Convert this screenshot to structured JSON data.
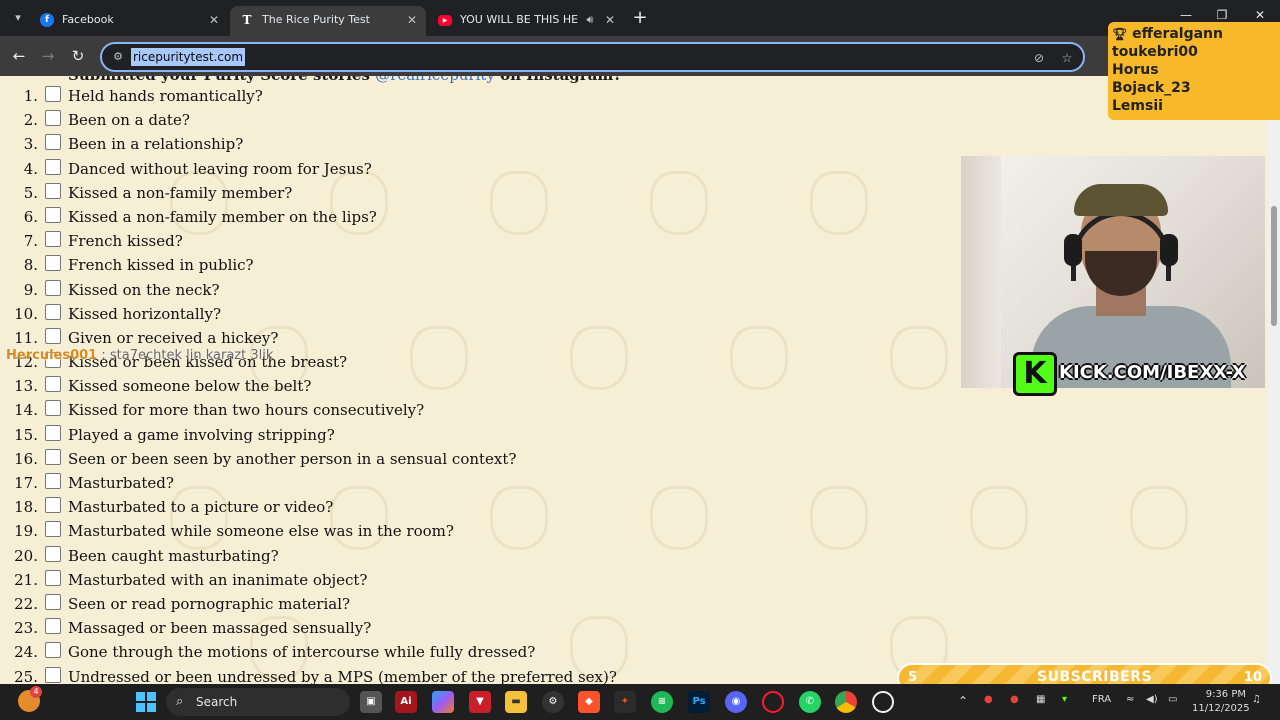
{
  "browser": {
    "tabs": [
      {
        "title": "Facebook",
        "favicon": "facebook-icon",
        "color": "#1877f2"
      },
      {
        "title": "The Rice Purity Test",
        "favicon": "t-logo-icon",
        "color": "#ffffff"
      },
      {
        "title": "YOU WILL BE THIS HERO | C",
        "favicon": "youtube-icon",
        "color": "#ff0033"
      }
    ],
    "url": "ricepuritytest.com"
  },
  "page": {
    "partial_line": "Submitted your Purity Score stories ",
    "partial_handle": "@realricepurity",
    "partial_tail": " on Instagram?",
    "questions": [
      {
        "num": "1.",
        "text": "Held hands romantically?"
      },
      {
        "num": "2.",
        "text": "Been on a date?"
      },
      {
        "num": "3.",
        "text": "Been in a relationship?"
      },
      {
        "num": "4.",
        "text": "Danced without leaving room for Jesus?"
      },
      {
        "num": "5.",
        "text": "Kissed a non-family member?"
      },
      {
        "num": "6.",
        "text": "Kissed a non-family member on the lips?"
      },
      {
        "num": "7.",
        "text": "French kissed?"
      },
      {
        "num": "8.",
        "text": "French kissed in public?"
      },
      {
        "num": "9.",
        "text": "Kissed on the neck?"
      },
      {
        "num": "10.",
        "text": "Kissed horizontally?"
      },
      {
        "num": "11.",
        "text": "Given or received a hickey?"
      },
      {
        "num": "12.",
        "text": "Kissed or been kissed on the breast?"
      },
      {
        "num": "13.",
        "text": "Kissed someone below the belt?"
      },
      {
        "num": "14.",
        "text": "Kissed for more than two hours consecutively?"
      },
      {
        "num": "15.",
        "text": "Played a game involving stripping?"
      },
      {
        "num": "16.",
        "text": "Seen or been seen by another person in a sensual context?"
      },
      {
        "num": "17.",
        "text": "Masturbated?"
      },
      {
        "num": "18.",
        "text": "Masturbated to a picture or video?"
      },
      {
        "num": "19.",
        "text": "Masturbated while someone else was in the room?"
      },
      {
        "num": "20.",
        "text": "Been caught masturbating?"
      },
      {
        "num": "21.",
        "text": "Masturbated with an inanimate object?"
      },
      {
        "num": "22.",
        "text": "Seen or read pornographic material?"
      },
      {
        "num": "23.",
        "text": "Massaged or been massaged sensually?"
      },
      {
        "num": "24.",
        "text": "Gone through the motions of intercourse while fully dressed?"
      },
      {
        "num": "25.",
        "text": "Undressed or been undressed by a MPS (member of the preferred sex)?"
      }
    ]
  },
  "overlay": {
    "chat_user": "Hercules001",
    "chat_message": " : sta7echtek lin karazt 3lik",
    "top_subs": [
      "efferalgann",
      "toukebri00",
      "Horus",
      "Bojack_23",
      "Lemsii"
    ],
    "kick_url": "KICK.COM/IBEXX-X",
    "sub_goal": {
      "current": "5",
      "label": "SUBSCRIBERS",
      "target": "10",
      "progress": 0.5
    }
  },
  "taskbar": {
    "search": "Search",
    "weather_badge": "4",
    "language": "FRA",
    "time": "9:36 PM",
    "date": "11/12/2025"
  }
}
